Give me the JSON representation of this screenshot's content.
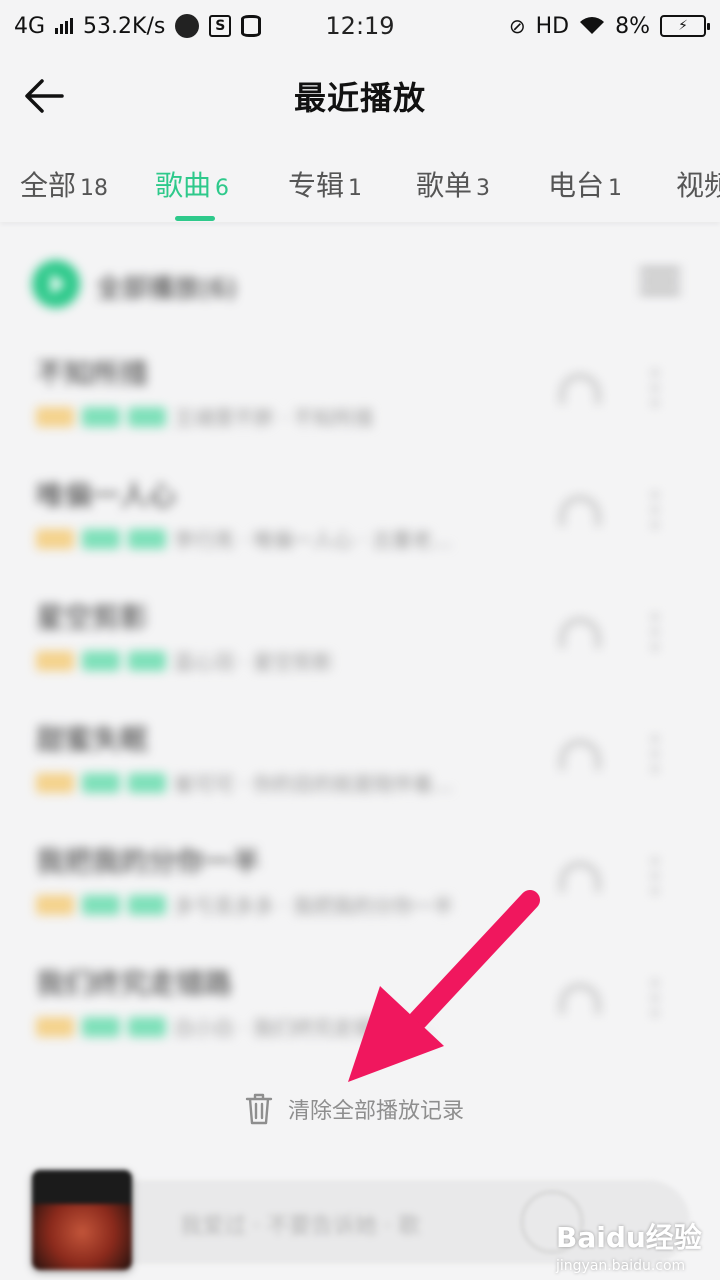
{
  "status_bar": {
    "network": "4G",
    "speed": "53.2K/s",
    "time": "12:19",
    "hd": "HD",
    "battery": "8%"
  },
  "header": {
    "title": "最近播放"
  },
  "tabs": [
    {
      "label": "全部",
      "count": "18"
    },
    {
      "label": "歌曲",
      "count": "6"
    },
    {
      "label": "专辑",
      "count": "1"
    },
    {
      "label": "歌单",
      "count": "3"
    },
    {
      "label": "电台",
      "count": "1"
    },
    {
      "label": "视频",
      "count": ""
    }
  ],
  "list": {
    "play_all_label": "全部播放(6)",
    "songs": [
      {
        "title": "不知所措",
        "subtitle": "王靖雯不胖 · 不知所措"
      },
      {
        "title": "唯偏一人心",
        "subtitle": "李行亮 · 唯偏一人心 · 古董老…"
      },
      {
        "title": "星空剪影",
        "subtitle": "蓝心羽 · 星空剪影"
      },
      {
        "title": "甜蜜失眠",
        "subtitle": "崔可可 · 你的目的就是陪伴着…"
      },
      {
        "title": "我把我的分你一半",
        "subtitle": "多亏丢多多 · 我把我的分你一半"
      },
      {
        "title": "我们终究走错路",
        "subtitle": "白小白 · 我们终究走错路 · …"
      }
    ]
  },
  "clear_label": "清除全部播放记录",
  "player": {
    "text": "我爱过 · 不要告诉她 · 歌"
  },
  "watermark": {
    "logo": "Baidu经验",
    "url": "jingyan.baidu.com"
  },
  "colors": {
    "accent": "#2ec98b",
    "annotation_arrow": "#f0175e"
  }
}
